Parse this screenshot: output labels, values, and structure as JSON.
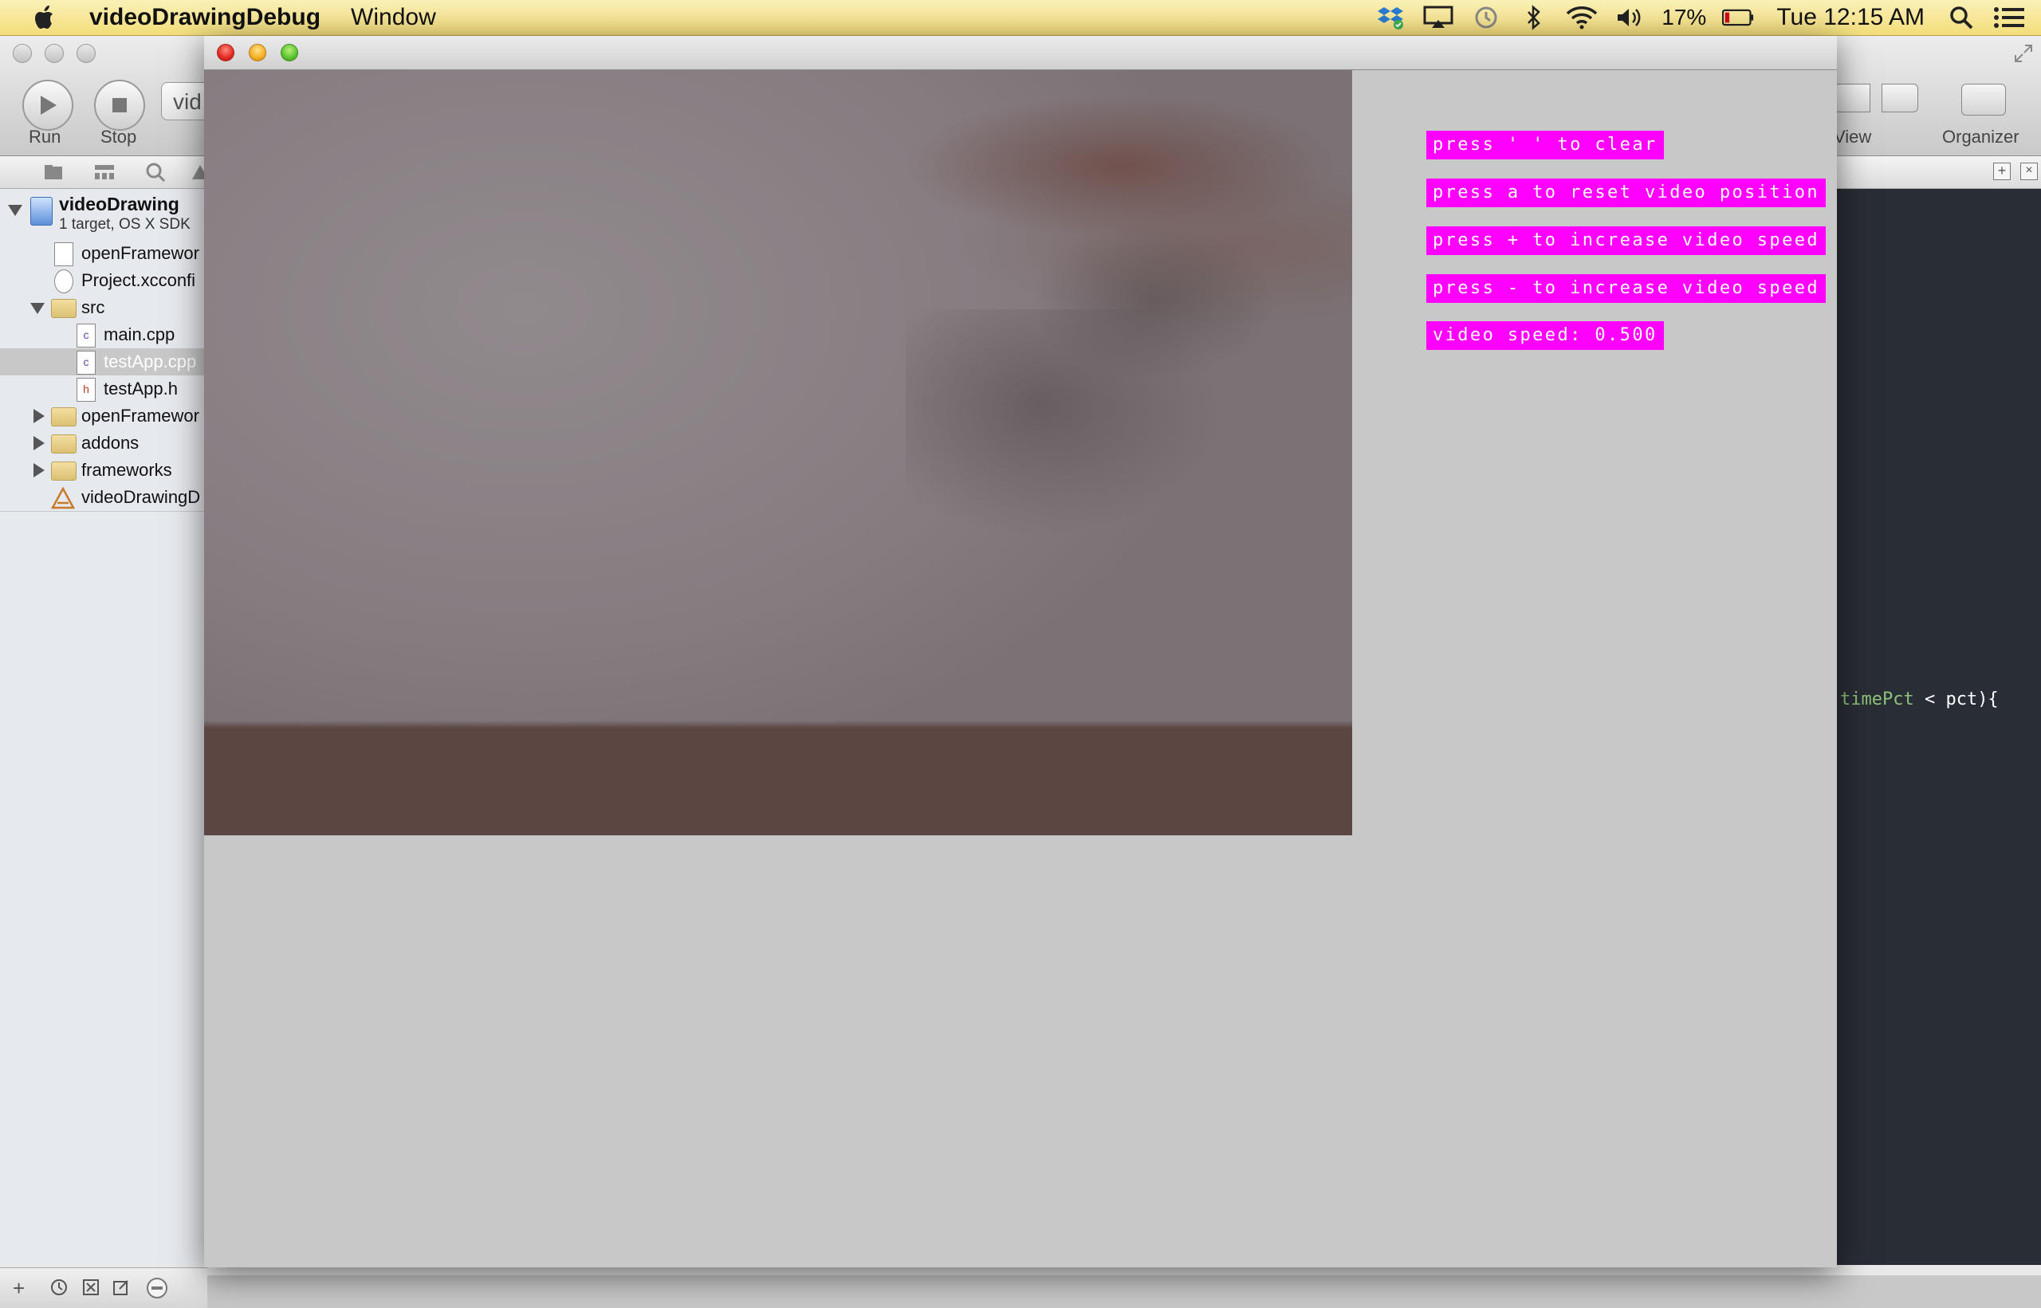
{
  "menubar": {
    "app_name": "videoDrawingDebug",
    "items": [
      "Window"
    ],
    "battery": "17%",
    "clock": "Tue 12:15 AM",
    "icons": [
      "apple-icon",
      "dropbox-icon",
      "airplay-icon",
      "time-machine-icon",
      "bluetooth-icon",
      "wifi-icon",
      "volume-icon",
      "battery-icon",
      "spotlight-icon",
      "notification-center-icon"
    ]
  },
  "xcode": {
    "run_label": "Run",
    "stop_label": "Stop",
    "scheme_text": "vid",
    "view_label": "View",
    "organizer_label": "Organizer",
    "project": {
      "name": "videoDrawing",
      "subtitle": "1 target, OS X SDK"
    },
    "files": [
      {
        "label": "openFramewor",
        "icon": "document-icon"
      },
      {
        "label": "Project.xcconfi",
        "icon": "config-icon"
      },
      {
        "label": "src",
        "icon": "folder-icon"
      },
      {
        "label": "main.cpp",
        "icon": "cpp-file-icon"
      },
      {
        "label": "testApp.cpp",
        "icon": "cpp-file-icon"
      },
      {
        "label": "testApp.h",
        "icon": "header-file-icon"
      },
      {
        "label": "openFramewor",
        "icon": "folder-icon"
      },
      {
        "label": "addons",
        "icon": "folder-icon"
      },
      {
        "label": "frameworks",
        "icon": "folder-icon"
      },
      {
        "label": "videoDrawingD",
        "icon": "app-target-icon"
      }
    ],
    "code": {
      "token1": "timePct",
      "token2": " < pct){"
    }
  },
  "app_window": {
    "labels": [
      "press ' ' to clear",
      "press a to reset video position",
      "press + to increase video speed",
      "press - to increase video speed",
      "video speed: 0.500"
    ],
    "label_color": "#ff00ff"
  }
}
